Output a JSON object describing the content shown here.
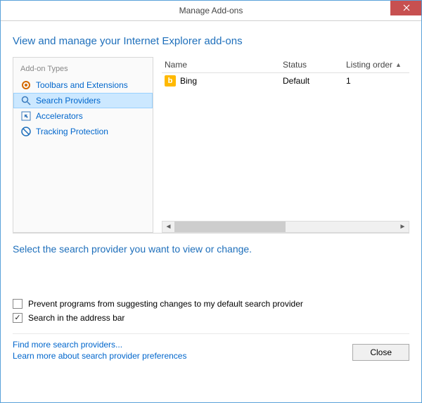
{
  "window": {
    "title": "Manage Add-ons"
  },
  "header": {
    "title": "View and manage your Internet Explorer add-ons"
  },
  "sidebar": {
    "heading": "Add-on Types",
    "items": [
      {
        "label": "Toolbars and Extensions",
        "icon": "gear"
      },
      {
        "label": "Search Providers",
        "icon": "search"
      },
      {
        "label": "Accelerators",
        "icon": "arrow"
      },
      {
        "label": "Tracking Protection",
        "icon": "block"
      }
    ]
  },
  "list": {
    "columns": {
      "name": "Name",
      "status": "Status",
      "order": "Listing order"
    },
    "rows": [
      {
        "name": "Bing",
        "status": "Default",
        "order": "1"
      }
    ]
  },
  "info": {
    "text": "Select the search provider you want to view or change."
  },
  "options": {
    "prevent_changes": "Prevent programs from suggesting changes to my default search provider",
    "search_addressbar": "Search in the address bar"
  },
  "footer": {
    "find_more": "Find more search providers...",
    "learn_more": "Learn more about search provider preferences",
    "close": "Close"
  }
}
